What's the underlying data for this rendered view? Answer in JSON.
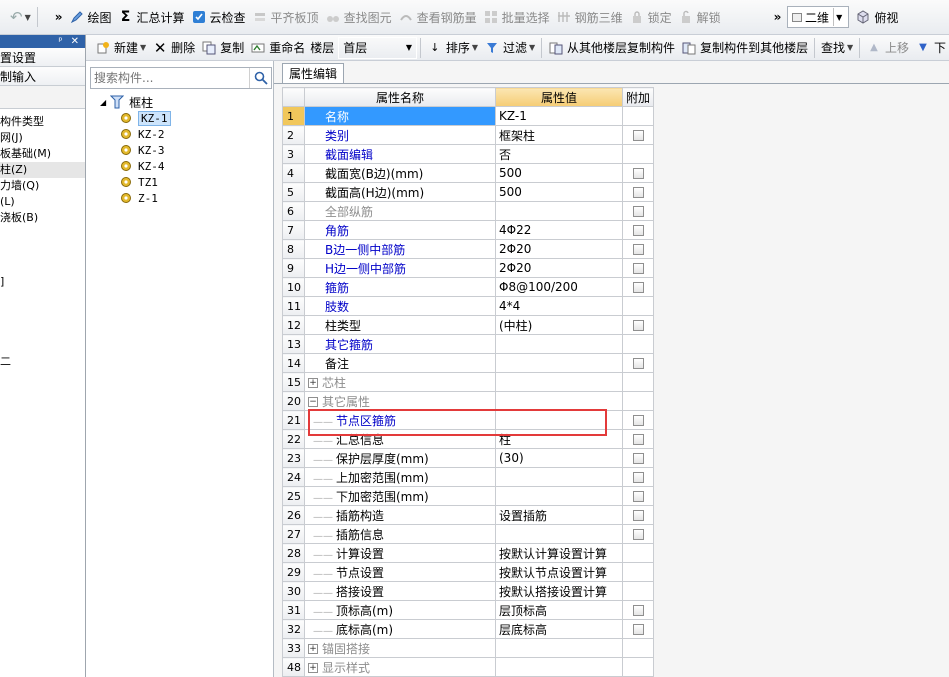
{
  "toolbar1": {
    "undo_label": "↶",
    "items": [
      {
        "name": "draw-button",
        "label": "绘图",
        "icon": "draw-icon",
        "disabled": false
      },
      {
        "name": "summary-calc-button",
        "label": "汇总计算",
        "icon": "sigma-icon",
        "disabled": false
      },
      {
        "name": "cloud-check-button",
        "label": "云检查",
        "icon": "cloud-check-icon",
        "disabled": false
      },
      {
        "name": "align-slab-top-button",
        "label": "平齐板顶",
        "icon": "align-icon",
        "disabled": true
      },
      {
        "name": "find-element-button",
        "label": "查找图元",
        "icon": "binoculars-icon",
        "disabled": true
      },
      {
        "name": "view-rebar-qty-button",
        "label": "查看钢筋量",
        "icon": "rebar-icon",
        "disabled": true
      },
      {
        "name": "batch-select-button",
        "label": "批量选择",
        "icon": "grid-select-icon",
        "disabled": true
      },
      {
        "name": "rebar-3d-button",
        "label": "钢筋三维",
        "icon": "rebar-3d-icon",
        "disabled": true
      },
      {
        "name": "lock-button",
        "label": "锁定",
        "icon": "lock-icon",
        "disabled": true
      },
      {
        "name": "unlock-button",
        "label": "解锁",
        "icon": "unlock-icon",
        "disabled": true
      }
    ],
    "view_mode": "二维",
    "top_view_label": "俯视"
  },
  "left_panel": {
    "header_pin": "ᵖ",
    "header_close": "✕",
    "row1": "置设置",
    "row2": "制输入",
    "items": [
      "构件类型",
      "网(J)",
      "板基础(M)",
      "柱(Z)",
      "力墙(Q)",
      "(L)",
      "浇板(B)",
      "",
      "",
      "",
      "]",
      "",
      "",
      "",
      "",
      "二"
    ],
    "selected_index": 3
  },
  "toolbar2": {
    "new_label": "新建",
    "delete_label": "删除",
    "copy_label": "复制",
    "rename_label": "重命名",
    "floor_label": "楼层",
    "floor_value": "首层",
    "sort_label": "排序",
    "filter_label": "过滤",
    "copy_from_label": "从其他楼层复制构件",
    "copy_to_label": "复制构件到其他楼层",
    "find_label": "查找",
    "move_up_label": "上移",
    "move_down_label": "下"
  },
  "tree": {
    "search_placeholder": "搜索构件...",
    "root_label": "框柱",
    "nodes": [
      "KZ-1",
      "KZ-2",
      "KZ-3",
      "KZ-4",
      "TZ1",
      "Z-1"
    ],
    "selected_index": 0
  },
  "props": {
    "tab_label": "属性编辑",
    "headers": {
      "name": "属性名称",
      "value": "属性值",
      "extra": "附加"
    },
    "rows": [
      {
        "num": "1",
        "name": "名称",
        "value": "KZ-1",
        "style": "blue",
        "check": false,
        "sel": true
      },
      {
        "num": "2",
        "name": "类别",
        "value": "框架柱",
        "style": "blue",
        "check": true
      },
      {
        "num": "3",
        "name": "截面编辑",
        "value": "否",
        "style": "blue",
        "check": false
      },
      {
        "num": "4",
        "name": "截面宽(B边)(mm)",
        "value": "500",
        "style": "",
        "check": true
      },
      {
        "num": "5",
        "name": "截面高(H边)(mm)",
        "value": "500",
        "style": "",
        "check": true
      },
      {
        "num": "6",
        "name": "全部纵筋",
        "value": "",
        "style": "gray",
        "check": true
      },
      {
        "num": "7",
        "name": "角筋",
        "value": "4Φ22",
        "style": "blue",
        "check": true
      },
      {
        "num": "8",
        "name": "B边一侧中部筋",
        "value": "2Φ20",
        "style": "blue",
        "check": true
      },
      {
        "num": "9",
        "name": "H边一侧中部筋",
        "value": "2Φ20",
        "style": "blue",
        "check": true
      },
      {
        "num": "10",
        "name": "箍筋",
        "value": "Φ8@100/200",
        "style": "blue",
        "check": true
      },
      {
        "num": "11",
        "name": "肢数",
        "value": "4*4",
        "style": "blue",
        "check": false
      },
      {
        "num": "12",
        "name": "柱类型",
        "value": "(中柱)",
        "style": "",
        "check": true
      },
      {
        "num": "13",
        "name": "其它箍筋",
        "value": "",
        "style": "blue",
        "check": false
      },
      {
        "num": "14",
        "name": "备注",
        "value": "",
        "style": "",
        "check": true
      },
      {
        "num": "15",
        "name": "芯柱",
        "value": "",
        "style": "gray",
        "check": false,
        "group": "+"
      },
      {
        "num": "20",
        "name": "其它属性",
        "value": "",
        "style": "gray",
        "check": false,
        "group": "−"
      },
      {
        "num": "21",
        "name": "节点区箍筋",
        "value": "",
        "style": "blue",
        "check": true,
        "child": true
      },
      {
        "num": "22",
        "name": "汇总信息",
        "value": "柱",
        "style": "",
        "check": true,
        "child": true
      },
      {
        "num": "23",
        "name": "保护层厚度(mm)",
        "value": "(30)",
        "style": "",
        "check": true,
        "child": true
      },
      {
        "num": "24",
        "name": "上加密范围(mm)",
        "value": "",
        "style": "",
        "check": true,
        "child": true
      },
      {
        "num": "25",
        "name": "下加密范围(mm)",
        "value": "",
        "style": "",
        "check": true,
        "child": true
      },
      {
        "num": "26",
        "name": "插筋构造",
        "value": "设置插筋",
        "style": "",
        "check": true,
        "child": true
      },
      {
        "num": "27",
        "name": "插筋信息",
        "value": "",
        "style": "",
        "check": true,
        "child": true
      },
      {
        "num": "28",
        "name": "计算设置",
        "value": "按默认计算设置计算",
        "style": "",
        "check": false,
        "child": true
      },
      {
        "num": "29",
        "name": "节点设置",
        "value": "按默认节点设置计算",
        "style": "",
        "check": false,
        "child": true
      },
      {
        "num": "30",
        "name": "搭接设置",
        "value": "按默认搭接设置计算",
        "style": "",
        "check": false,
        "child": true
      },
      {
        "num": "31",
        "name": "顶标高(m)",
        "value": "层顶标高",
        "style": "",
        "check": true,
        "child": true
      },
      {
        "num": "32",
        "name": "底标高(m)",
        "value": "层底标高",
        "style": "",
        "check": true,
        "child": true
      },
      {
        "num": "33",
        "name": "锚固搭接",
        "value": "",
        "style": "gray",
        "check": false,
        "group": "+"
      },
      {
        "num": "48",
        "name": "显示样式",
        "value": "",
        "style": "gray",
        "check": false,
        "group": "+"
      }
    ]
  },
  "colors": {
    "accent": "#3399ff",
    "header_value": "#f5cc74",
    "highlight_box": "#e33a3a",
    "blue_text": "#0000c8"
  }
}
